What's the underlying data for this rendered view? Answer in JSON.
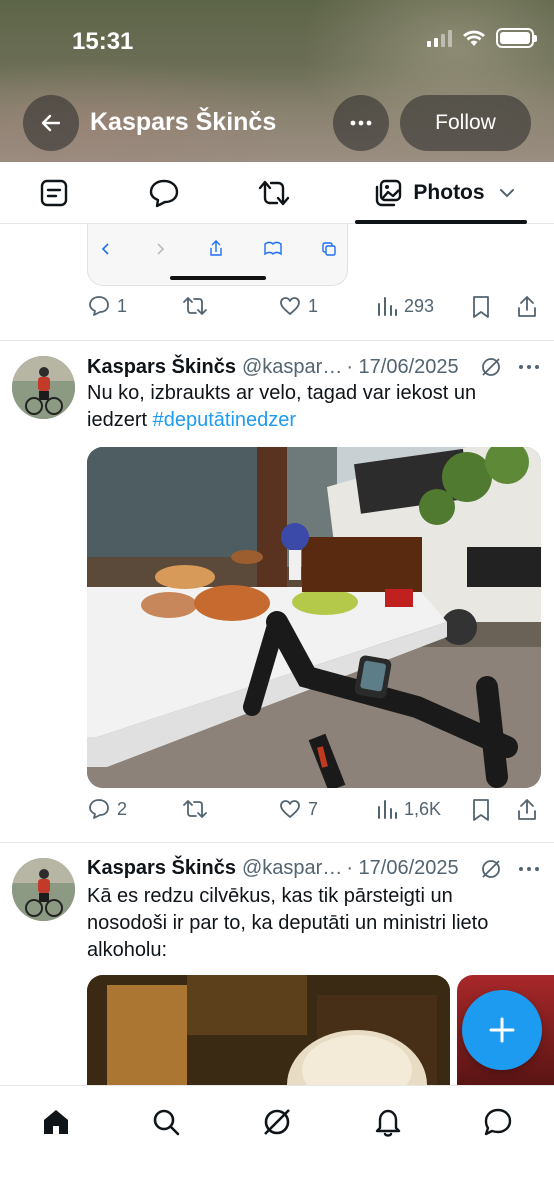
{
  "status_bar": {
    "time": "15:31"
  },
  "header": {
    "name": "Kaspars Škinčs",
    "follow_label": "Follow"
  },
  "tabs": {
    "photos_label": "Photos"
  },
  "prev_post": {
    "replies": "1",
    "reposts": "",
    "likes": "1",
    "views": "293"
  },
  "posts": [
    {
      "author": "Kaspars Škinčs",
      "handle": "@kaspar…",
      "date": "· 17/06/2025",
      "text": "Nu ko, izbraukts ar velo, tagad var iekost un iedzert ",
      "hashtag": "#deputātinedzer",
      "replies": "2",
      "likes": "7",
      "views": "1,6K"
    },
    {
      "author": "Kaspars Škinčs",
      "handle": "@kaspar…",
      "date": "· 17/06/2025",
      "text": "Kā es redzu cilvēkus, kas tik pārsteigti un nosodoši ir par to, ka deputāti un ministri lieto alkoholu:"
    }
  ],
  "colors": {
    "accent": "#1d9bf0",
    "text": "#0f1419",
    "muted": "#536471"
  }
}
